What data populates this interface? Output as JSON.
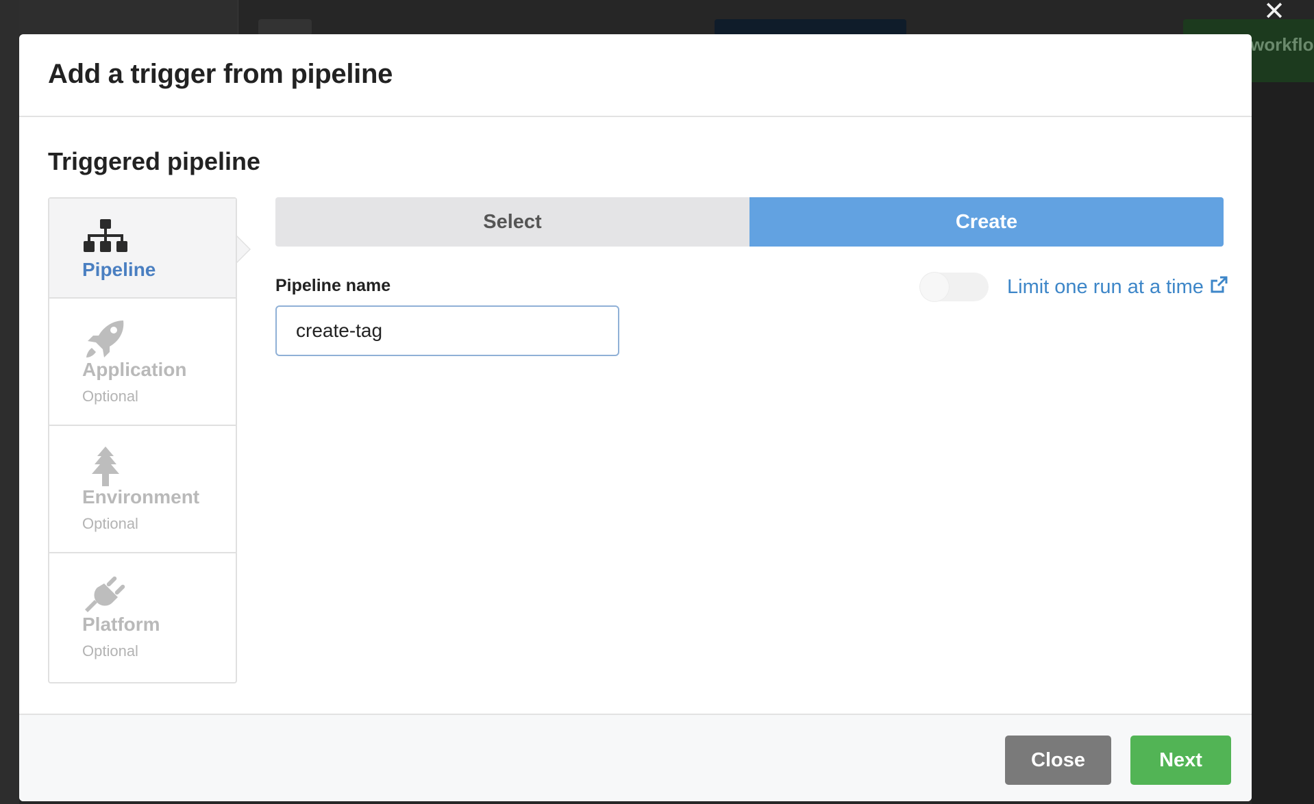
{
  "background": {
    "workflow_button_fragment": "workflo"
  },
  "modal": {
    "title": "Add a trigger from pipeline",
    "section_title": "Triggered pipeline",
    "steps": [
      {
        "label": "Pipeline",
        "sub": "",
        "icon": "sitemap-icon",
        "active": true
      },
      {
        "label": "Application",
        "sub": "Optional",
        "icon": "rocket-icon",
        "active": false
      },
      {
        "label": "Environment",
        "sub": "Optional",
        "icon": "tree-icon",
        "active": false
      },
      {
        "label": "Platform",
        "sub": "Optional",
        "icon": "plug-icon",
        "active": false
      }
    ],
    "segmented": {
      "select_label": "Select",
      "create_label": "Create",
      "selected": "Create"
    },
    "pipeline_name": {
      "label": "Pipeline name",
      "value": "create-tag"
    },
    "limit_toggle": {
      "label": "Limit one run at a time",
      "enabled": false
    },
    "footer": {
      "close_label": "Close",
      "next_label": "Next"
    }
  },
  "colors": {
    "accent_blue": "#62a2e1",
    "link_blue": "#3d86c8",
    "active_step_label": "#4a7fc1",
    "next_green": "#52b455",
    "close_gray": "#7a7a7a"
  }
}
